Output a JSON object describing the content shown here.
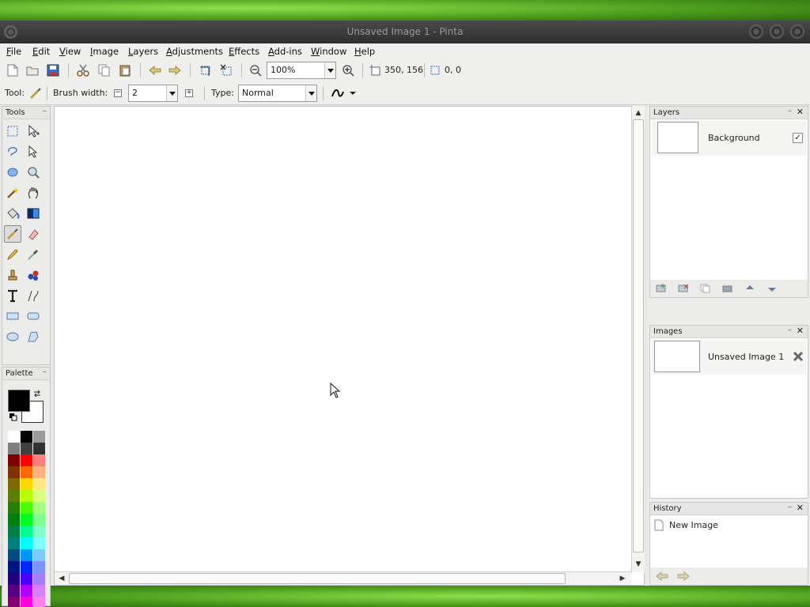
{
  "window": {
    "title": "Unsaved Image 1 - Pinta"
  },
  "menu": [
    {
      "label": "File",
      "u": "F",
      "rest": "ile"
    },
    {
      "label": "Edit",
      "u": "E",
      "rest": "dit"
    },
    {
      "label": "View",
      "u": "V",
      "rest": "iew"
    },
    {
      "label": "Image",
      "u": "I",
      "rest": "mage"
    },
    {
      "label": "Layers",
      "u": "L",
      "rest": "ayers"
    },
    {
      "label": "Adjustments",
      "u": "A",
      "rest": "djustments"
    },
    {
      "label": "Effects",
      "u": "E",
      "rest": "ffects"
    },
    {
      "label": "Add-ins",
      "u": "A",
      "rest": "dd-ins"
    },
    {
      "label": "Window",
      "u": "W",
      "rest": "indow"
    },
    {
      "label": "Help",
      "u": "H",
      "rest": "elp"
    }
  ],
  "toolbar": {
    "zoom_value": "100%",
    "image_size": "350, 156",
    "selection_size": "0, 0"
  },
  "tool_options": {
    "tool_label": "Tool:",
    "brush_width_label": "Brush width:",
    "brush_width_value": "2",
    "minus_glyph": "−",
    "plus_glyph": "+",
    "type_label": "Type:",
    "type_value": "Normal"
  },
  "tools_panel": {
    "title": "Tools",
    "active_tool": "paintbrush",
    "icons": [
      "rectangle-select-icon",
      "move-selected-icon",
      "lasso-select-icon",
      "move-selection-icon",
      "ellipse-select-icon",
      "zoom-icon",
      "magic-wand-icon",
      "pan-icon",
      "paint-bucket-icon",
      "gradient-icon",
      "paintbrush-icon",
      "eraser-icon",
      "pencil-icon",
      "color-picker-icon",
      "clone-stamp-icon",
      "recolor-icon",
      "text-icon",
      "line-curve-icon",
      "rectangle-icon",
      "rounded-rectangle-icon",
      "ellipse-icon",
      "freeform-shape-icon"
    ]
  },
  "palette_panel": {
    "title": "Palette",
    "primary_color": "#000000",
    "secondary_color": "#ffffff",
    "swatches": [
      [
        "#ffffff",
        "#000000",
        "#9a9a9a"
      ],
      [
        "#808080",
        "#404040",
        "#303030"
      ],
      [
        "#7f0000",
        "#ff0000",
        "#ff7f7f"
      ],
      [
        "#7f3300",
        "#ff6a00",
        "#ffb27f"
      ],
      [
        "#7f6a00",
        "#ffd800",
        "#ffe97f"
      ],
      [
        "#5b7f00",
        "#b6ff00",
        "#daff7f"
      ],
      [
        "#267f00",
        "#4cff00",
        "#a5ff7f"
      ],
      [
        "#007f0e",
        "#00ff21",
        "#7fff8e"
      ],
      [
        "#007f46",
        "#00ff90",
        "#7fffc5"
      ],
      [
        "#007f7f",
        "#00ffff",
        "#7fffff"
      ],
      [
        "#004a7f",
        "#0094ff",
        "#7fc9ff"
      ],
      [
        "#00137f",
        "#0026ff",
        "#7f92ff"
      ],
      [
        "#21007f",
        "#4800ff",
        "#a17fff"
      ],
      [
        "#57007f",
        "#b200ff",
        "#d67fff"
      ],
      [
        "#7f006e",
        "#ff00dc",
        "#ff7fed"
      ]
    ]
  },
  "layers_panel": {
    "title": "Layers",
    "min_glyph": "–",
    "close_glyph": "✕",
    "items": [
      {
        "name": "Background",
        "visible_glyph": "✓"
      }
    ]
  },
  "images_panel": {
    "title": "Images",
    "items": [
      {
        "name": "Unsaved Image 1"
      }
    ]
  },
  "history_panel": {
    "title": "History",
    "items": [
      {
        "name": "New Image"
      }
    ]
  },
  "colors": {
    "accent_blue": "#3a6ec8",
    "icon_gray": "#6a6a6a",
    "titlebar": "#3a3a3a"
  }
}
